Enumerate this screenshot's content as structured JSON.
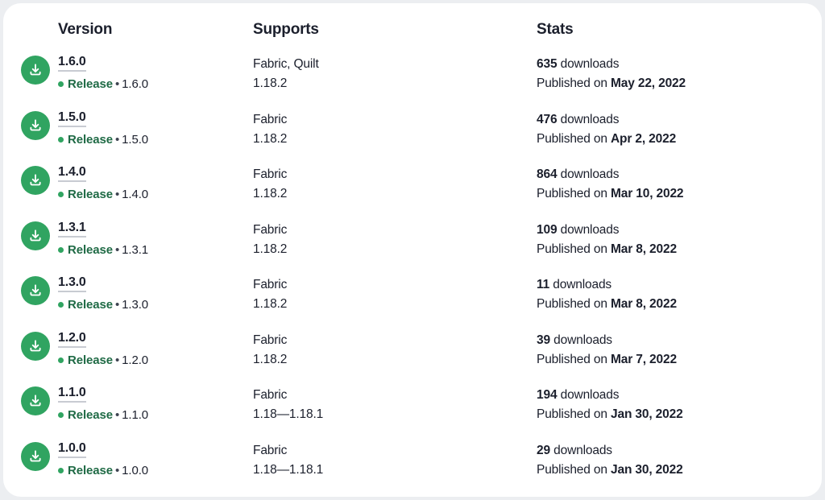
{
  "theme": {
    "accent_green": "#30a461",
    "channel_text_green": "#1f6a45",
    "text_dark": "#1b1f2c",
    "underline_gray": "#c8cbd2",
    "page_background": "#eceef1",
    "card_background": "#ffffff"
  },
  "table": {
    "columns": {
      "version": "Version",
      "supports": "Supports",
      "stats": "Stats"
    },
    "published_prefix": "Published on",
    "downloads_suffix": "downloads",
    "download_icon": "download-icon",
    "rows": [
      {
        "version": "1.6.0",
        "channel": "Release",
        "channel_version": "1.6.0",
        "loaders": "Fabric, Quilt",
        "game_versions": "1.18.2",
        "downloads": "635",
        "published_date": "May 22, 2022"
      },
      {
        "version": "1.5.0",
        "channel": "Release",
        "channel_version": "1.5.0",
        "loaders": "Fabric",
        "game_versions": "1.18.2",
        "downloads": "476",
        "published_date": "Apr 2, 2022"
      },
      {
        "version": "1.4.0",
        "channel": "Release",
        "channel_version": "1.4.0",
        "loaders": "Fabric",
        "game_versions": "1.18.2",
        "downloads": "864",
        "published_date": "Mar 10, 2022"
      },
      {
        "version": "1.3.1",
        "channel": "Release",
        "channel_version": "1.3.1",
        "loaders": "Fabric",
        "game_versions": "1.18.2",
        "downloads": "109",
        "published_date": "Mar 8, 2022"
      },
      {
        "version": "1.3.0",
        "channel": "Release",
        "channel_version": "1.3.0",
        "loaders": "Fabric",
        "game_versions": "1.18.2",
        "downloads": "11",
        "published_date": "Mar 8, 2022"
      },
      {
        "version": "1.2.0",
        "channel": "Release",
        "channel_version": "1.2.0",
        "loaders": "Fabric",
        "game_versions": "1.18.2",
        "downloads": "39",
        "published_date": "Mar 7, 2022"
      },
      {
        "version": "1.1.0",
        "channel": "Release",
        "channel_version": "1.1.0",
        "loaders": "Fabric",
        "game_versions": "1.18—1.18.1",
        "downloads": "194",
        "published_date": "Jan 30, 2022"
      },
      {
        "version": "1.0.0",
        "channel": "Release",
        "channel_version": "1.0.0",
        "loaders": "Fabric",
        "game_versions": "1.18—1.18.1",
        "downloads": "29",
        "published_date": "Jan 30, 2022"
      }
    ]
  }
}
